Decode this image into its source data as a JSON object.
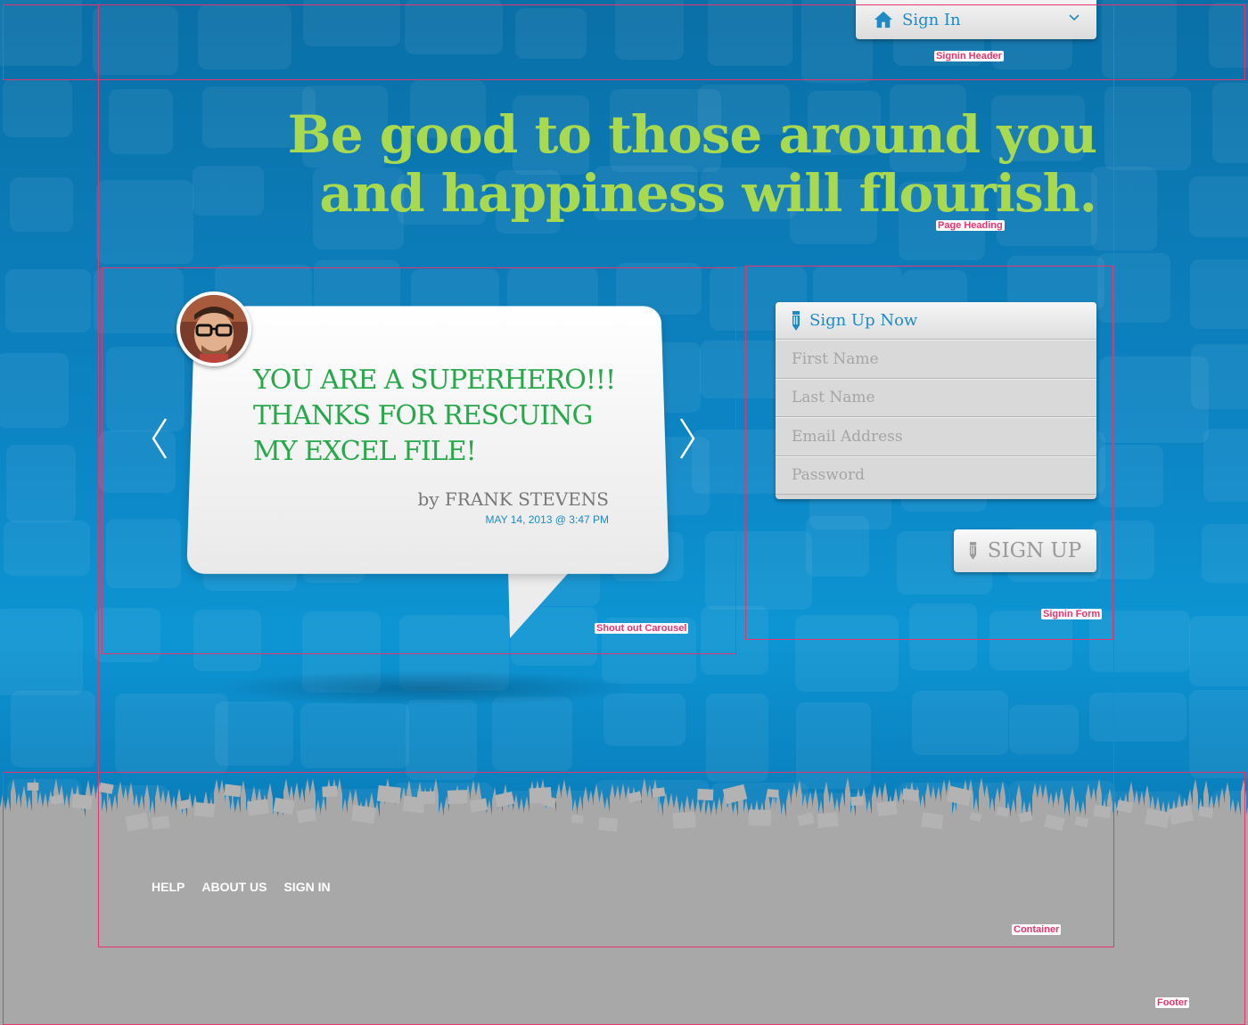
{
  "header": {
    "signin_label": "Sign In"
  },
  "heading": {
    "line1": "Be good to those around you",
    "line2": "and happiness will flourish."
  },
  "carousel": {
    "quote_line1": "YOU ARE A SUPERHERO!!!",
    "quote_line2": "THANKS FOR RESCUING",
    "quote_line3": "MY EXCEL FILE!",
    "author": "by FRANK STEVENS",
    "date": "MAY 14, 2013 @ 3:47 PM"
  },
  "signup": {
    "title": "Sign Up Now",
    "first_name_placeholder": "First Name",
    "last_name_placeholder": "Last Name",
    "email_placeholder": "Email Address",
    "password_placeholder": "Password",
    "button_label": "SIGN UP"
  },
  "footer": {
    "links": [
      "HELP",
      "ABOUT US",
      "SIGN IN"
    ]
  },
  "annotations": {
    "signin_header": "Signin Header",
    "page_heading": "Page Heading",
    "carousel": "Shout out Carousel",
    "signin_form": "Signin Form",
    "container": "Container",
    "footer": "Footer"
  },
  "colors": {
    "background_blue": "#0c86c6",
    "heading_green": "#a9d94f",
    "quote_green": "#27a84a",
    "link_blue": "#1f8ac6",
    "annotation_pink": "#e8336d",
    "footer_gray": "#a8a8a8"
  },
  "icons": [
    "home-icon",
    "chevron-down-icon",
    "pencil-icon",
    "arrow-left-icon",
    "arrow-right-icon"
  ]
}
